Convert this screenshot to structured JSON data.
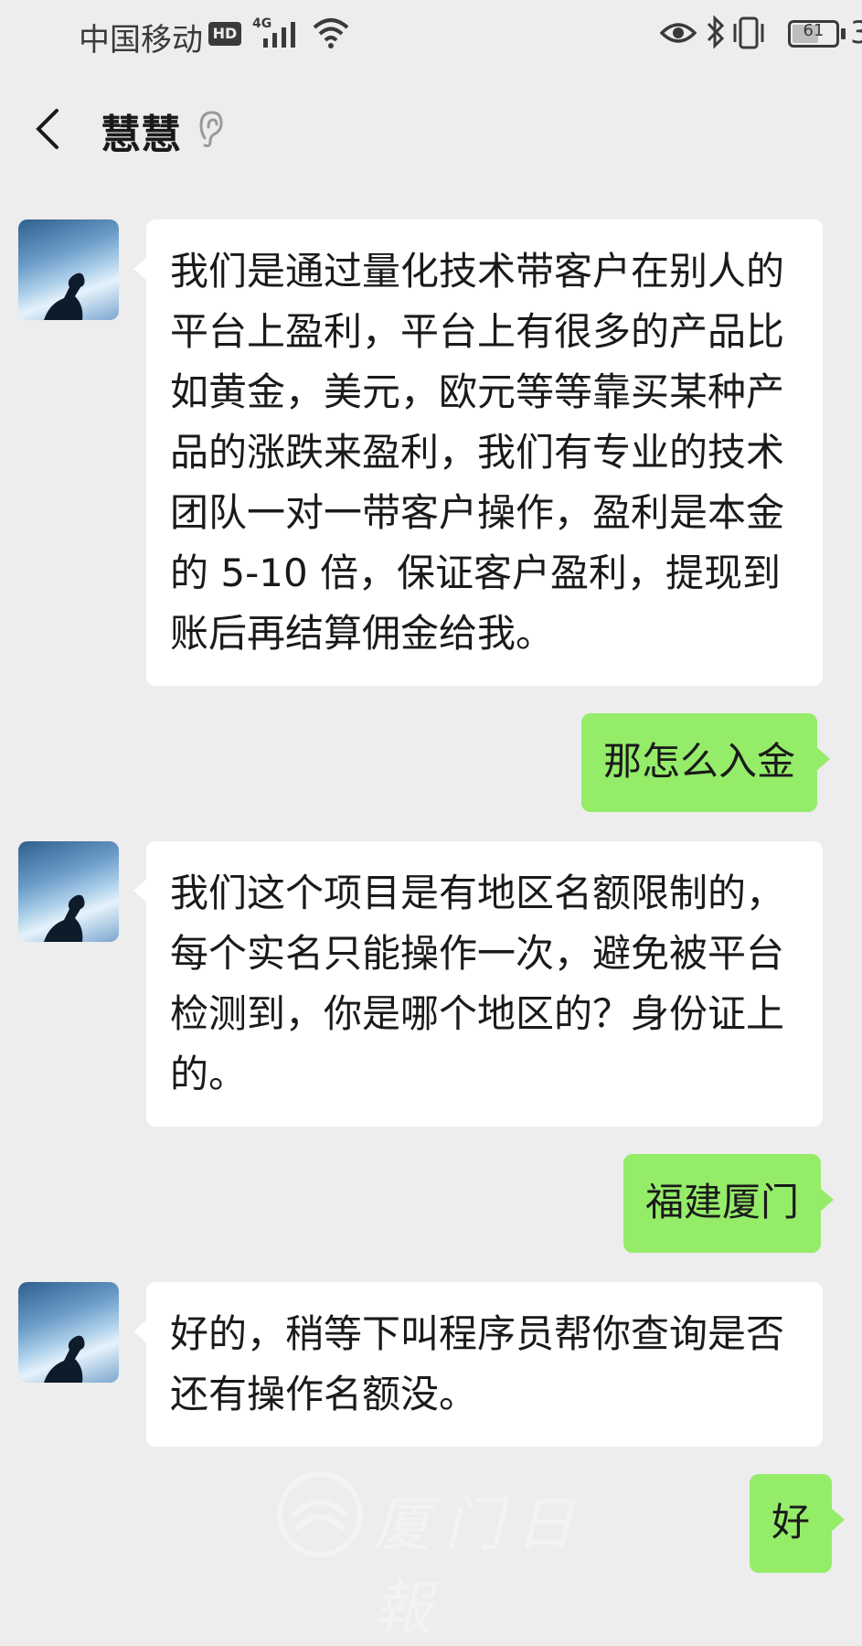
{
  "status_bar": {
    "carrier": "中国移动",
    "hd": "HD",
    "network": "4G",
    "battery": "61",
    "battery_level": 0.61,
    "clock_partial": "3"
  },
  "header": {
    "contact_name": "慧慧"
  },
  "messages": [
    {
      "from": "contact",
      "text": "我们是通过量化技术带客户在别人的平台上盈利，平台上有很多的产品比如黄金，美元，欧元等等靠买某种产品的涨跌来盈利，我们有专业的技术团队一对一带客户操作，盈利是本金的 5-10 倍，保证客户盈利，提现到账后再结算佣金给我。"
    },
    {
      "from": "me",
      "text": "那怎么入金"
    },
    {
      "from": "contact",
      "text": "我们这个项目是有地区名额限制的，每个实名只能操作一次，避免被平台检测到，你是哪个地区的？身份证上的。"
    },
    {
      "from": "me",
      "text": "福建厦门"
    },
    {
      "from": "contact",
      "text": "好的，稍等下叫程序员帮你查询是否还有操作名额没。"
    },
    {
      "from": "me",
      "text": "好"
    }
  ],
  "watermark": "厦门日報",
  "colors": {
    "background": "#ededed",
    "incoming_bubble": "#ffffff",
    "outgoing_bubble": "#95ec69"
  }
}
